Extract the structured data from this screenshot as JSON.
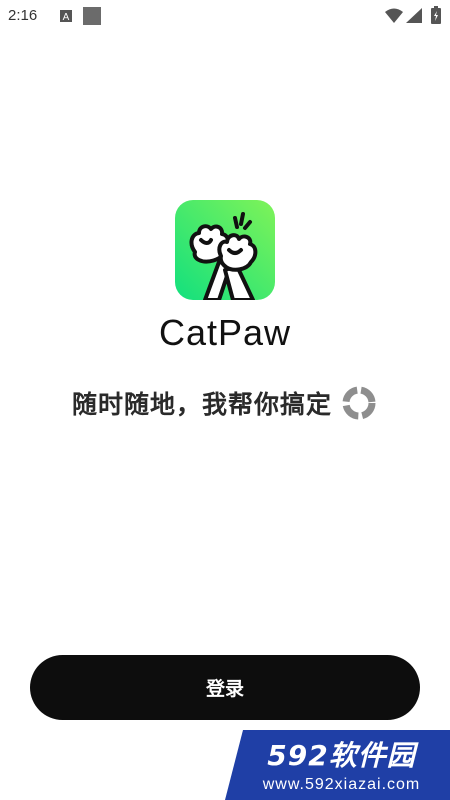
{
  "status_bar": {
    "time": "2:16",
    "icons": [
      "a-notification-icon",
      "square-notification-icon",
      "wifi-icon",
      "signal-icon",
      "battery-icon"
    ]
  },
  "app": {
    "name": "CatPaw",
    "tagline": "随时随地，我帮你搞定",
    "logo_icon": "cat-paw-high-five-icon",
    "loading_icon": "loading-spinner-icon",
    "accent_gradient": [
      "#1EE58A",
      "#7CF25A"
    ]
  },
  "login": {
    "label": "登录",
    "color": "#0d0d0d"
  },
  "watermark": {
    "brand": "592软件园",
    "url": "www.592xiazai.com",
    "color": "#1f3fa6"
  }
}
